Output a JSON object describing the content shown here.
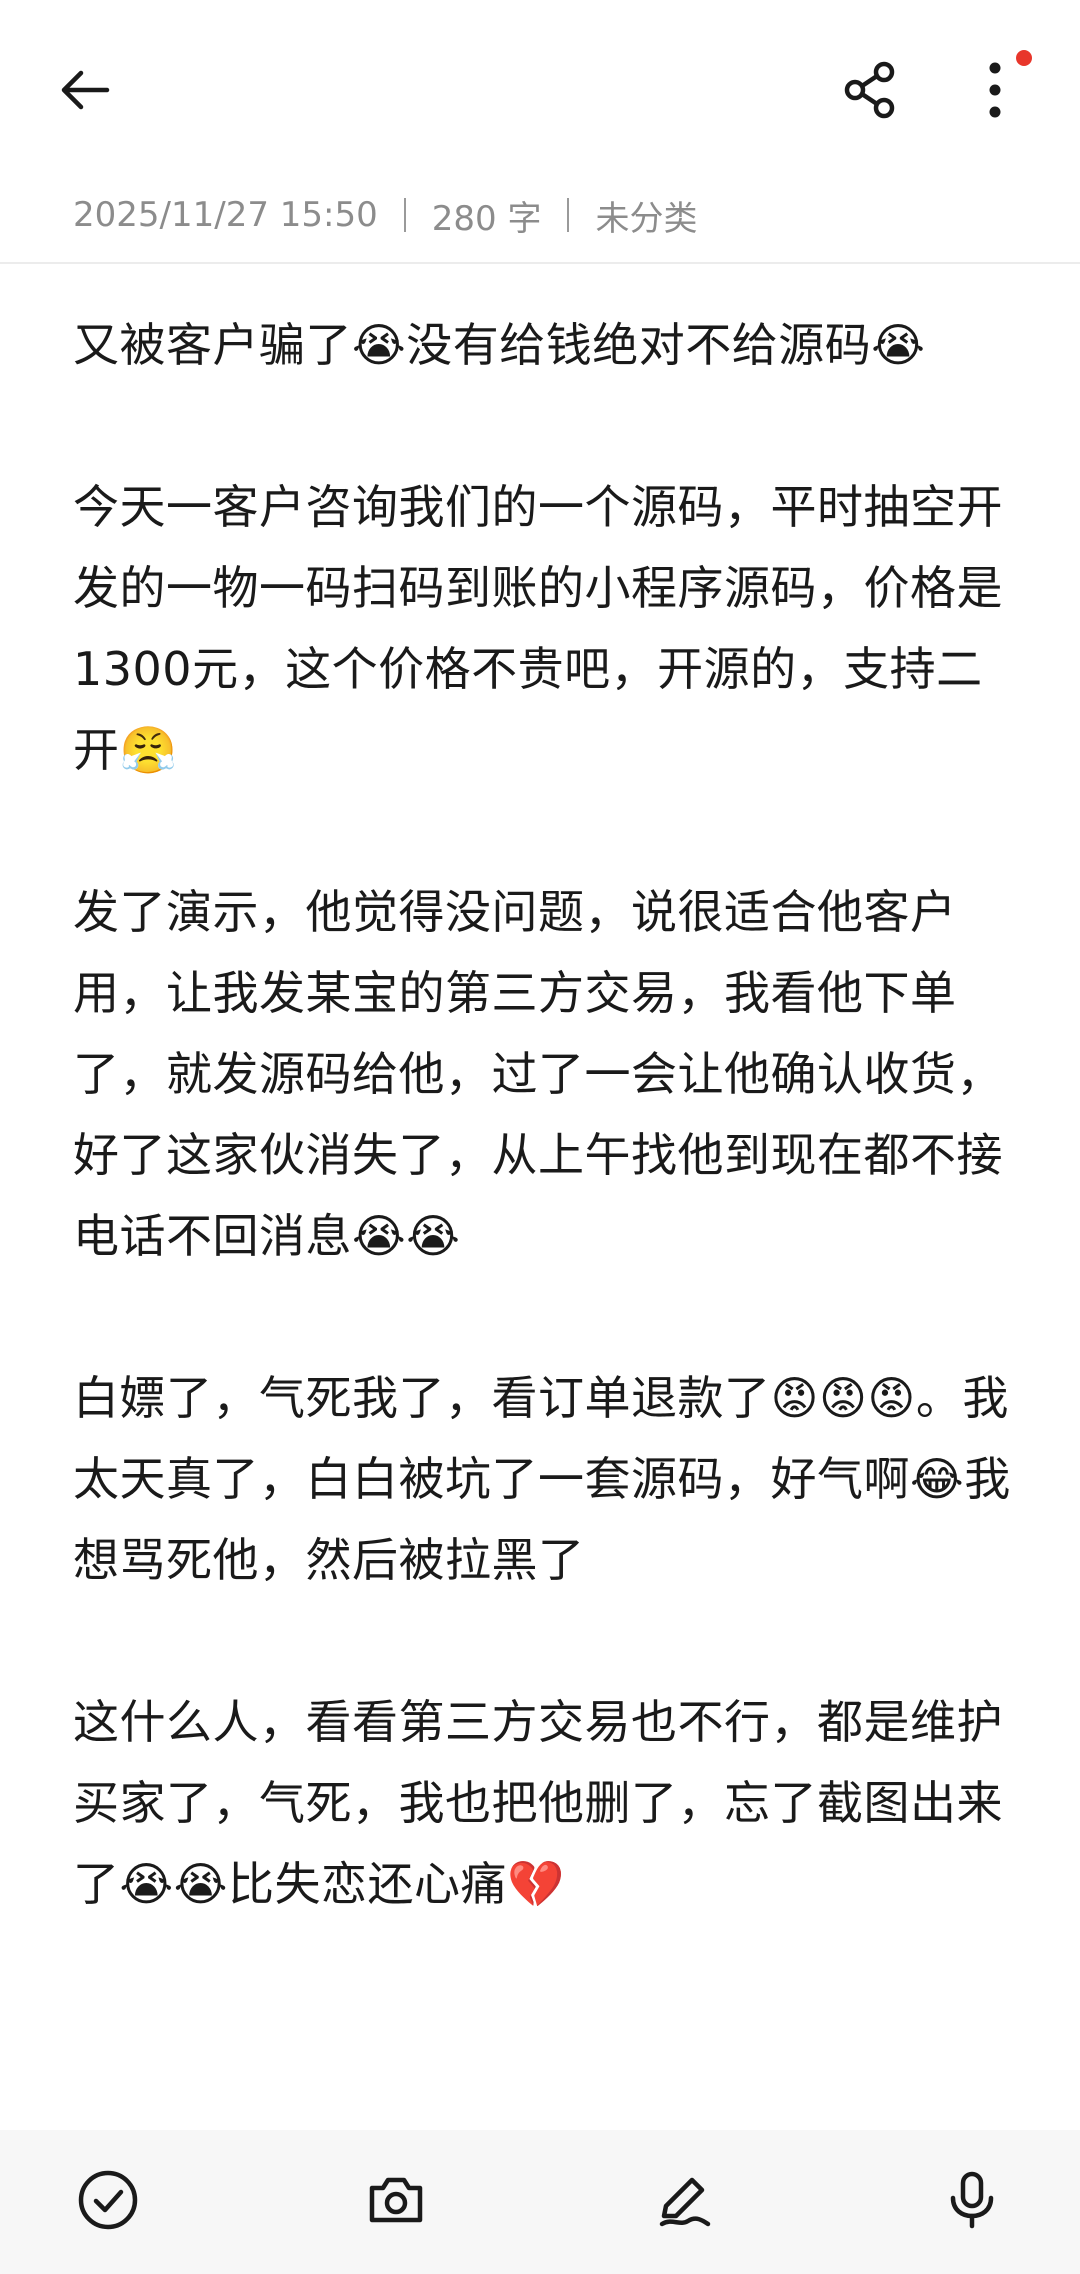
{
  "meta": {
    "date": "2025/11/27 15:50",
    "word_count": "280 字",
    "category": "未分类"
  },
  "note": {
    "paragraphs": [
      "又被客户骗了😭没有给钱绝对不给源码😭",
      "今天一客户咨询我们的一个源码，平时抽空开发的一物一码扫码到账的小程序源码，价格是1300元，这个价格不贵吧，开源的，支持二开😤",
      "发了演示，他觉得没问题，说很适合他客户用，让我发某宝的第三方交易，我看他下单了，就发源码给他，过了一会让他确认收货，好了这家伙消失了，从上午找他到现在都不接电话不回消息😭😭",
      "白嫖了，气死我了，看订单退款了😡😡😡。我太天真了，白白被坑了一套源码，好气啊😂我想骂死他，然后被拉黑了",
      "这什么人，看看第三方交易也不行，都是维护买家了，气死，我也把他删了，忘了截图出来了😭😭比失恋还心痛💔"
    ]
  },
  "icons": {
    "back": "arrow-left-icon",
    "share": "share-icon",
    "more": "more-vertical-icon",
    "checklist": "check-circle-icon",
    "camera": "camera-icon",
    "handwriting": "pen-icon",
    "voice": "microphone-icon"
  },
  "colors": {
    "notification_dot": "#e8362b",
    "meta_text": "#8c8c8c",
    "body_text": "#1a1a1a",
    "bottom_bar_bg": "#f7f7f7"
  }
}
